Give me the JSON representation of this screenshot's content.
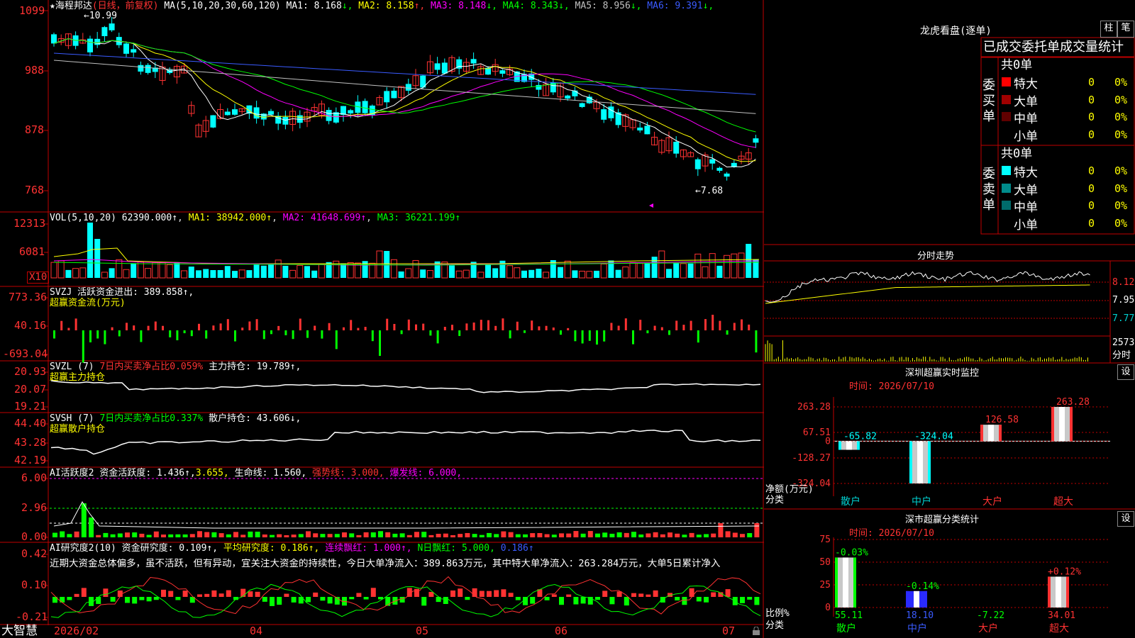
{
  "app_name": "大智慧",
  "main_chart": {
    "title": "海程邦达",
    "period": "(日线，前复权)",
    "ma_params": "MA(5,10,20,30,60,120)",
    "ma_items": [
      {
        "label": "MA1:",
        "value": "8.168",
        "arrow": "↓",
        "color": "#ffffff",
        "arrow_color": "#00ff00"
      },
      {
        "label": "MA2:",
        "value": "8.158",
        "arrow": "↑",
        "color": "#ffff00",
        "arrow_color": "#ff3232"
      },
      {
        "label": "MA3:",
        "value": "8.148",
        "arrow": "↓",
        "color": "#ff00ff",
        "arrow_color": "#00ff00"
      },
      {
        "label": "MA4:",
        "value": "8.343",
        "arrow": "↓",
        "color": "#00ff00",
        "arrow_color": "#00ff00"
      },
      {
        "label": "MA5:",
        "value": "8.956",
        "arrow": "↓",
        "color": "#c0c0c0",
        "arrow_color": "#00ff00"
      },
      {
        "label": "MA6:",
        "value": "9.391",
        "arrow": "↓",
        "color": "#3a5bff",
        "arrow_color": "#00ff00"
      }
    ],
    "y_ticks": [
      "1099",
      "988",
      "878",
      "768"
    ],
    "high_marker": "10.99",
    "low_marker": "7.68"
  },
  "vol_panel": {
    "header": "VOL(5,10,20)",
    "value": "62390.000↑",
    "ma1": "MA1: 38942.000↑",
    "ma2": "MA2: 41648.699↑",
    "ma3": "MA3: 36221.199↑",
    "y_ticks": [
      "12313",
      "6081"
    ],
    "unit": "X10"
  },
  "svzj_panel": {
    "header": "SVZJ",
    "label": "活跃资金进出: 389.858↑,",
    "subtitle": "超赢资金流(万元)",
    "y_ticks": [
      "773.36",
      "40.16",
      "-693.04"
    ]
  },
  "svzl_panel": {
    "header": "SVZL (7)",
    "ratio": "7日内买卖净占比0.059%",
    "hold": "主力持仓: 19.789↑,",
    "subtitle": "超赢主力持仓",
    "y_ticks": [
      "20.93",
      "20.07",
      "19.21"
    ]
  },
  "svsh_panel": {
    "header": "SVSH (7)",
    "ratio": "7日内买卖净占比0.337%",
    "hold": "散户持仓: 43.606↓,",
    "subtitle": "超赢散户持仓",
    "y_ticks": [
      "44.40",
      "43.28",
      "42.19"
    ]
  },
  "ai_active_panel": {
    "header": "AI活跃度2",
    "a": "资金活跃度: 1.436↑,",
    "b": "3.655,",
    "c": "生命线: 1.560,",
    "d": "强势线: 3.000,",
    "e": "爆发线: 6.000,",
    "y_ticks": [
      "6.00",
      "2.96",
      "0.00"
    ]
  },
  "ai_research_panel": {
    "header": "AI研究度2(10)",
    "a": "资金研究度: 0.109↑,",
    "b": "平均研究度: 0.186↑,",
    "c": "连续飘红: 1.000↑,",
    "d": "N日飘红: 5.000,",
    "e": "0.186↑",
    "commentary": "近期大资金总体偏多，虽不活跃，但有异动，宜关注大资金的持续性，今日大单净流入：389.863万元，其中特大单净流入：263.284万元，大单5日累计净入",
    "y_ticks": [
      "0.42",
      "0.10",
      "-0.21"
    ]
  },
  "date_axis": [
    "2026/02",
    "04",
    "05",
    "06",
    "07"
  ],
  "right": {
    "longhu_title": "龙虎看盘(逐单)",
    "btn_bar": "柱",
    "btn_pen": "笔",
    "stat_header": "已成交委托单成交量统计",
    "buy_side": {
      "label": "委买单",
      "count": "共0单",
      "rows": [
        {
          "name": "特大",
          "count": "0",
          "pct": "0%",
          "color": "#ff0000"
        },
        {
          "name": "大单",
          "count": "0",
          "pct": "0%",
          "color": "#a00000"
        },
        {
          "name": "中单",
          "count": "0",
          "pct": "0%",
          "color": "#600000"
        },
        {
          "name": "小单",
          "count": "0",
          "pct": "0%",
          "color": ""
        }
      ]
    },
    "sell_side": {
      "label": "委卖单",
      "count": "共0单",
      "rows": [
        {
          "name": "特大",
          "count": "0",
          "pct": "0%",
          "color": "#00ffff"
        },
        {
          "name": "大单",
          "count": "0",
          "pct": "0%",
          "color": "#008b8b"
        },
        {
          "name": "中单",
          "count": "0",
          "pct": "0%",
          "color": "#006b6b"
        },
        {
          "name": "小单",
          "count": "0",
          "pct": "0%",
          "color": ""
        }
      ]
    },
    "intraday": {
      "title": "分时走势",
      "y_ticks": [
        "8.12",
        "7.95",
        "7.77"
      ],
      "vol_tick": "2573",
      "vol_label": "分时"
    },
    "sz_monitor": {
      "title": "深圳超赢实时监控",
      "btn": "设",
      "time": "时间: 2026/07/10",
      "y_ticks": [
        "263.28",
        "67.51",
        "0",
        "-128.27",
        "-324.04"
      ],
      "y_label": "净额(万元)",
      "x_label": "分类",
      "categories": [
        "散户",
        "中户",
        "大户",
        "超大"
      ],
      "value_labels": [
        "-65.82",
        "-324.04",
        "126.58",
        "263.28"
      ]
    },
    "sz_category": {
      "title": "深市超赢分类统计",
      "btn": "设",
      "time": "时间: 2026/07/10",
      "y_ticks": [
        "75",
        "50",
        "25",
        "0"
      ],
      "y_label": "比例%",
      "x_label": "分类",
      "categories": [
        "散户",
        "中户",
        "大户",
        "超大"
      ],
      "change_labels": [
        "-0.03%",
        "-0.14%",
        "",
        "+0.12%"
      ],
      "value_labels": [
        "55.11",
        "18.10",
        "-7.22",
        "34.01"
      ]
    }
  },
  "chart_data": [
    {
      "type": "bar",
      "title": "深圳超赢实时监控",
      "ylabel": "净额(万元)",
      "xlabel": "分类",
      "categories": [
        "散户",
        "中户",
        "大户",
        "超大"
      ],
      "values": [
        -65.82,
        -324.04,
        126.58,
        263.28
      ],
      "ylim": [
        -324.04,
        263.28
      ]
    },
    {
      "type": "bar",
      "title": "深市超赢分类统计",
      "ylabel": "比例%",
      "xlabel": "分类",
      "categories": [
        "散户",
        "中户",
        "大户",
        "超大"
      ],
      "values": [
        55.11,
        18.1,
        -7.22,
        34.01
      ],
      "ylim": [
        0,
        75
      ]
    }
  ]
}
